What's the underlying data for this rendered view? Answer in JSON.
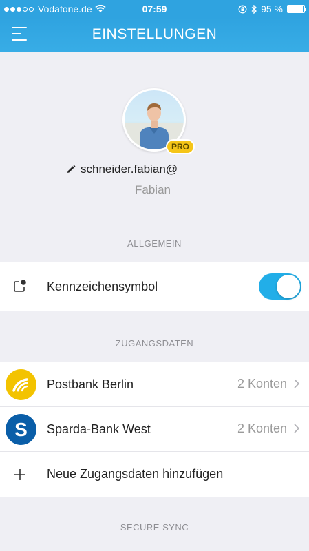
{
  "status_bar": {
    "carrier": "Vodafone.de",
    "time": "07:59",
    "battery": "95 %",
    "signal_bars_filled": 3,
    "signal_bars_total": 5,
    "battery_level_percent": 95
  },
  "nav": {
    "title": "EINSTELLUNGEN",
    "menu_icon": "hamburger-menu-icon"
  },
  "profile": {
    "badge": "PRO",
    "email": "schneider.fabian@",
    "name": "Fabian"
  },
  "sections": {
    "general": "ALLGEMEIN",
    "credentials": "ZUGANGSDATEN",
    "secure_sync": "SECURE SYNC"
  },
  "general": {
    "badge_symbol_label": "Kennzeichensymbol",
    "badge_symbol_enabled": true
  },
  "accounts": [
    {
      "name": "Postbank Berlin",
      "count": "2 Konten",
      "icon": "postbank-logo-icon",
      "color": "#f3c300"
    },
    {
      "name": "Sparda-Bank West",
      "count": "2 Konten",
      "icon": "sparda-logo-icon",
      "color": "#0a5ea8"
    }
  ],
  "add_credentials_label": "Neue Zugangsdaten hinzufügen",
  "colors": {
    "accent": "#2fa3e0",
    "toggle_on": "#22aee8",
    "pro_badge": "#f5c518"
  }
}
